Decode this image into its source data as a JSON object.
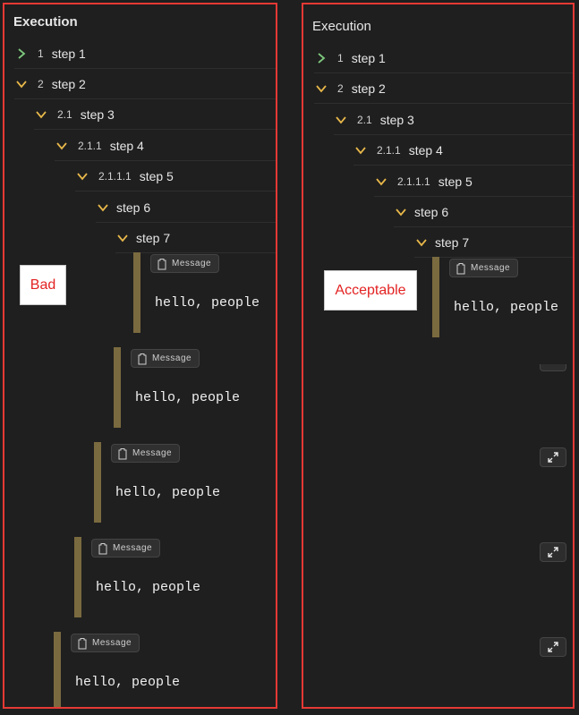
{
  "left_panel": {
    "title": "Execution",
    "tree": [
      {
        "num": "1",
        "name": "step 1",
        "expanded": false
      },
      {
        "num": "2",
        "name": "step 2",
        "expanded": true
      },
      {
        "num": "2.1",
        "name": "step 3",
        "expanded": true
      },
      {
        "num": "2.1.1",
        "name": "step 4",
        "expanded": true
      },
      {
        "num": "2.1.1.1",
        "name": "step 5",
        "expanded": true
      },
      {
        "num": "",
        "name": "step 6",
        "expanded": true
      },
      {
        "num": "",
        "name": "step 7",
        "expanded": true
      }
    ],
    "messages": [
      {
        "badge": "Message",
        "text": "hello, people"
      },
      {
        "badge": "Message",
        "text": "hello, people"
      },
      {
        "badge": "Message",
        "text": "hello, people"
      },
      {
        "badge": "Message",
        "text": "hello, people"
      },
      {
        "badge": "Message",
        "text": "hello, people"
      }
    ],
    "label": "Bad"
  },
  "right_panel": {
    "title": "Execution",
    "tree": [
      {
        "num": "1",
        "name": "step 1",
        "expanded": false
      },
      {
        "num": "2",
        "name": "step 2",
        "expanded": true
      },
      {
        "num": "2.1",
        "name": "step 3",
        "expanded": true
      },
      {
        "num": "2.1.1",
        "name": "step 4",
        "expanded": true
      },
      {
        "num": "2.1.1.1",
        "name": "step 5",
        "expanded": true
      },
      {
        "num": "",
        "name": "step 6",
        "expanded": true
      },
      {
        "num": "",
        "name": "step 7",
        "expanded": true
      }
    ],
    "messages": [
      {
        "badge": "Message",
        "text": "hello, people"
      }
    ],
    "expand_icon": "expand-icon",
    "label": "Acceptable"
  },
  "icons": {
    "chevron_right": "chevron-right-icon",
    "chevron_down": "chevron-down-icon",
    "message": "clipboard-icon",
    "expand": "expand-icon"
  },
  "colors": {
    "background": "#1f1f1f",
    "chevron_collapsed": "#7ec87e",
    "chevron_expanded": "#e8b84a",
    "message_bar": "#7a6a3f",
    "panel_border": "#e53935",
    "label_text": "#e32222"
  }
}
